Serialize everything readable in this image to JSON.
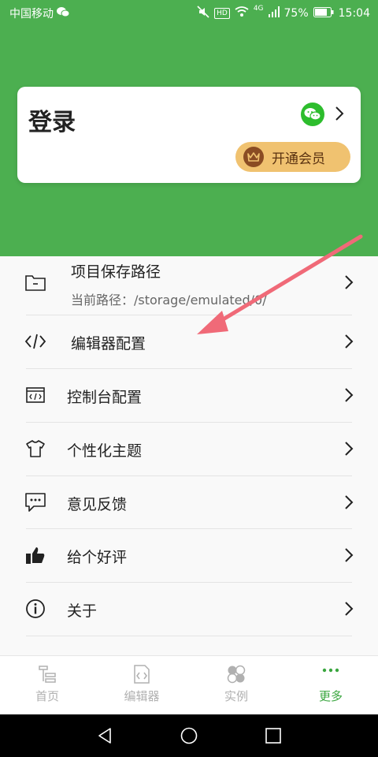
{
  "status_bar": {
    "carrier": "中国移动",
    "battery": "75%",
    "time": "15:04",
    "hd": "HD",
    "net": "4G"
  },
  "login_card": {
    "title": "登录",
    "vip_label": "开通会员"
  },
  "settings": {
    "items": [
      {
        "label": "项目保存路径",
        "sub": "当前路径：/storage/emulated/0/",
        "icon": "folder-icon"
      },
      {
        "label": "编辑器配置",
        "icon": "code-icon"
      },
      {
        "label": "控制台配置",
        "icon": "console-icon"
      },
      {
        "label": "个性化主题",
        "icon": "shirt-icon"
      },
      {
        "label": "意见反馈",
        "icon": "feedback-icon"
      },
      {
        "label": "给个好评",
        "icon": "thumbs-up-icon"
      },
      {
        "label": "关于",
        "icon": "info-icon"
      }
    ]
  },
  "bottom_nav": {
    "items": [
      {
        "label": "首页",
        "icon": "home-icon"
      },
      {
        "label": "编辑器",
        "icon": "editor-icon"
      },
      {
        "label": "实例",
        "icon": "examples-icon"
      },
      {
        "label": "更多",
        "icon": "more-icon"
      }
    ],
    "active": "更多"
  },
  "colors": {
    "primary_green": "#4caf50",
    "nav_active": "#3aa63f",
    "vip_gold": "#f0c270",
    "annotation_arrow": "#f06a78"
  }
}
